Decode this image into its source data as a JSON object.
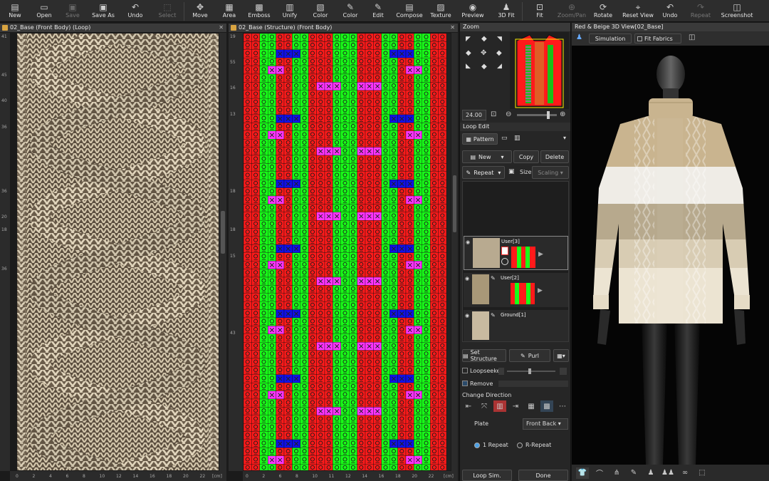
{
  "toolbar": [
    {
      "label": "New",
      "icon": "new-file-icon",
      "glyph": "▤",
      "enabled": true
    },
    {
      "label": "Open",
      "icon": "open-folder-icon",
      "glyph": "▭",
      "enabled": true
    },
    {
      "label": "Save",
      "icon": "save-icon",
      "glyph": "▣",
      "enabled": false
    },
    {
      "label": "Save As",
      "icon": "save-as-icon",
      "glyph": "▣",
      "enabled": true
    },
    {
      "label": "Undo",
      "icon": "undo-icon",
      "glyph": "↶",
      "enabled": true
    },
    {
      "label": "Select",
      "icon": "select-icon",
      "glyph": "⬚",
      "enabled": false
    },
    {
      "label": "Move",
      "icon": "move-icon",
      "glyph": "✥",
      "enabled": true
    },
    {
      "label": "Area",
      "icon": "area-icon",
      "glyph": "▦",
      "enabled": true
    },
    {
      "label": "Emboss",
      "icon": "emboss-icon",
      "glyph": "▩",
      "enabled": true
    },
    {
      "label": "Unify",
      "icon": "unify-icon",
      "glyph": "▥",
      "enabled": true
    },
    {
      "label": "Color",
      "icon": "color-icon",
      "glyph": "▧",
      "enabled": true
    },
    {
      "label": "Color",
      "icon": "color-picker-icon",
      "glyph": "✎",
      "enabled": true
    },
    {
      "label": "Edit",
      "icon": "edit-icon",
      "glyph": "✎",
      "enabled": true
    },
    {
      "label": "Compose",
      "icon": "compose-icon",
      "glyph": "▤",
      "enabled": true
    },
    {
      "label": "Texture",
      "icon": "texture-icon",
      "glyph": "▨",
      "enabled": true
    },
    {
      "label": "Preview",
      "icon": "preview-icon",
      "glyph": "◉",
      "enabled": true
    },
    {
      "label": "3D Fit",
      "icon": "3d-fit-icon",
      "glyph": "♟",
      "enabled": true
    },
    {
      "label": "Fit",
      "icon": "fit-icon",
      "glyph": "⊡",
      "enabled": true
    },
    {
      "label": "Zoom/Pan",
      "icon": "zoom-pan-icon",
      "glyph": "⊕",
      "enabled": false
    },
    {
      "label": "Rotate",
      "icon": "rotate-icon",
      "glyph": "⟳",
      "enabled": true
    },
    {
      "label": "Reset View",
      "icon": "reset-view-icon",
      "glyph": "⌖",
      "enabled": true
    },
    {
      "label": "Undo",
      "icon": "undo-3d-icon",
      "glyph": "↶",
      "enabled": true
    },
    {
      "label": "Repeat",
      "icon": "repeat-icon",
      "glyph": "↷",
      "enabled": false
    },
    {
      "label": "Screenshot",
      "icon": "screenshot-icon",
      "glyph": "◫",
      "enabled": true
    }
  ],
  "loop_panel": {
    "title": "02_Base (Front Body) (Loop)",
    "x_ticks": [
      "0",
      "2",
      "4",
      "6",
      "8",
      "10",
      "12",
      "14",
      "16",
      "18",
      "20",
      "22"
    ],
    "y_ticks": [
      "41",
      "",
      "",
      "45",
      "",
      "40",
      "",
      "36",
      "",
      "",
      "",
      "",
      "36",
      "",
      "20",
      "18",
      "",
      "",
      "36",
      "",
      "",
      "",
      "",
      "",
      "",
      "",
      "",
      "",
      "",
      "",
      "",
      "",
      "",
      ""
    ],
    "unit": "[cm]"
  },
  "structure_panel": {
    "title": "02_Base (Structure) (Front Body)",
    "x_ticks": [
      "0",
      "2",
      "6",
      "8",
      "10",
      "11",
      "12",
      "14",
      "16",
      "18",
      "20",
      "22"
    ],
    "y_ticks": [
      "19",
      "",
      "55",
      "",
      "16",
      "",
      "13",
      "",
      "",
      "",
      "",
      "",
      "18",
      "",
      "",
      "18",
      "",
      "15",
      "",
      "",
      "",
      "",
      "",
      "43",
      "",
      "",
      "",
      "",
      "",
      "",
      "",
      "",
      "",
      ""
    ],
    "unit": "[cm]"
  },
  "zoom": {
    "title": "Zoom",
    "value": "24.00"
  },
  "loop_edit": {
    "title": "Loop Edit",
    "pattern_label": "Pattern",
    "new_label": "New",
    "copy_label": "Copy",
    "delete_label": "Delete",
    "repeat_label": "Repeat",
    "size_label": "Size",
    "scaling_label": "Scaling",
    "layers": [
      {
        "name": "User[3]",
        "selected": true
      },
      {
        "name": "User[2]",
        "selected": false
      },
      {
        "name": "Ground[1]",
        "selected": false
      }
    ],
    "set_structure_label": "Set Structure",
    "purl_label": "Purl",
    "loopseeker_label": "Loopseeker",
    "remove_label": "Remove",
    "change_direction_label": "Change Direction",
    "plate_label": "Plate",
    "plate_value": "Front Back",
    "repeat_1_label": "1 Repeat",
    "repeat_r_label": "R-Repeat",
    "loop_sim_label": "Loop Sim.",
    "done_label": "Done"
  },
  "view3d": {
    "title": "Red & Beige 3D View[02_Base]",
    "simulation_label": "Simulation",
    "fit_fabrics_label": "Fit Fabrics"
  },
  "colors": {
    "red": "#ff1a1a",
    "green": "#18ff18",
    "blue": "#1010e6",
    "magenta": "#ff33ff",
    "yarn": "#cfc1a6"
  }
}
